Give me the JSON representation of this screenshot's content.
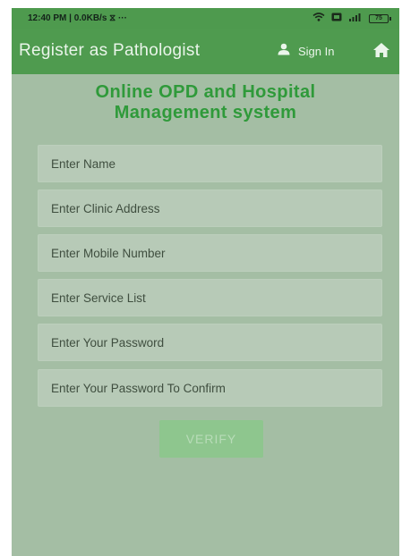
{
  "status_bar": {
    "time_info": "12:40 PM | 0.0KB/s ⧖ ···",
    "wifi_icon": "wifi-icon",
    "battery_level": "75"
  },
  "app_bar": {
    "title": "Register as Pathologist",
    "sign_in_label": "Sign In",
    "person_icon": "person-icon",
    "home_icon": "home-icon"
  },
  "headline": {
    "line1": "Online OPD and Hospital",
    "line2": "Management system"
  },
  "form": {
    "name_placeholder": "Enter Name",
    "clinic_address_placeholder": "Enter Clinic Address",
    "mobile_placeholder": "Enter Mobile Number",
    "service_list_placeholder": "Enter Service List",
    "password_placeholder": "Enter Your Password",
    "confirm_password_placeholder": "Enter Your Password To Confirm",
    "verify_label": "VERIFY"
  },
  "colors": {
    "app_bar": "#4f9b4f",
    "background": "#a4bea4",
    "headline": "#2f9a3a",
    "field_bg": "#b7cab7",
    "button_bg": "#8ec68e"
  }
}
